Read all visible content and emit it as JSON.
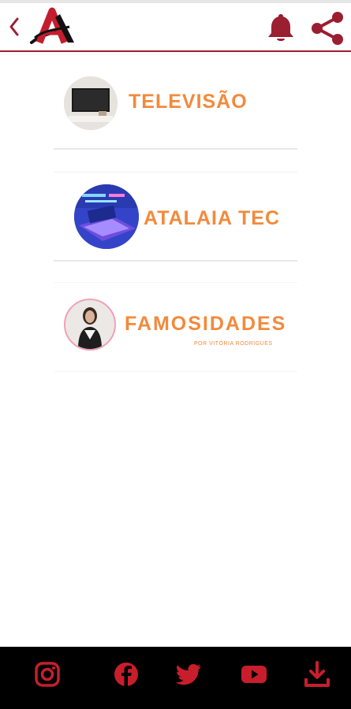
{
  "header": {
    "back_icon": "chevron-left-icon",
    "logo": "atalaia-logo",
    "notification_icon": "bell-icon",
    "share_icon": "share-icon",
    "accent_color": "#9a1f30"
  },
  "categories": [
    {
      "title": "TELEVISÃO",
      "thumbnail": "tv-thumbnail"
    },
    {
      "title": "ATALAIA TEC",
      "thumbnail": "tech-laptop-thumbnail"
    },
    {
      "title": "FAMOSIDADES",
      "subtitle": "POR VITÓRIA RODRIGUES",
      "thumbnail": "person-thumbnail"
    }
  ],
  "title_color": "#f28a3c",
  "footer": {
    "icons": [
      "instagram-icon",
      "facebook-icon",
      "twitter-icon",
      "youtube-icon",
      "download-icon"
    ],
    "icon_color": "#c81e2c",
    "background": "#000000"
  }
}
